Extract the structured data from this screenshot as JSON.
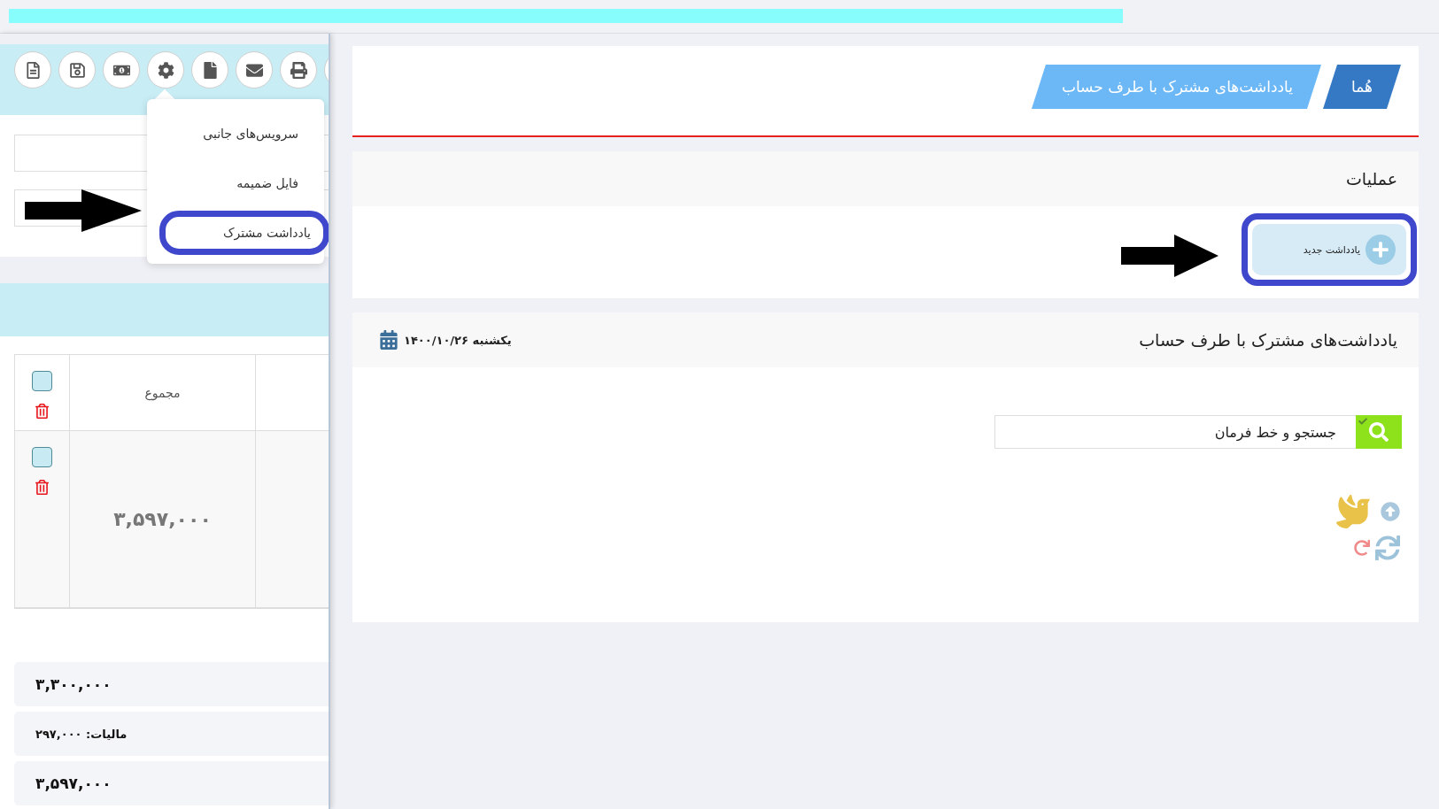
{
  "left_panel": {
    "toolbar": {
      "menu": [
        {
          "label": "سرویس‌های جانبی",
          "highlighted": false
        },
        {
          "label": "فایل ضمیمه",
          "highlighted": false
        },
        {
          "label": "یادداشت مشترک",
          "highlighted": true
        }
      ]
    },
    "table": {
      "select_all": {
        "checked": false
      },
      "columns": [
        "مجموع"
      ],
      "rows": [
        {
          "checked": false,
          "total": "۳,۵۹۷,۰۰۰"
        }
      ]
    },
    "summary": [
      {
        "kind": "amount",
        "text": "۳,۳۰۰,۰۰۰"
      },
      {
        "kind": "tax",
        "text": "مالیات: ۲۹۷,۰۰۰"
      },
      {
        "kind": "amount",
        "text": "۳,۵۹۷,۰۰۰"
      }
    ]
  },
  "breadcrumb": [
    "هُما",
    "یادداشت‌های مشترک با طرف حساب"
  ],
  "operations": {
    "title": "عملیات",
    "buttons": [
      {
        "label": "یادداشت جدید",
        "highlighted": true
      }
    ]
  },
  "notes": {
    "title": "یادداشت‌های مشترک با طرف حساب",
    "date": "یکشنبه ۱۴۰۰/۱۰/۲۶",
    "search": {
      "placeholder": "جستجو و خط فرمان"
    }
  }
}
